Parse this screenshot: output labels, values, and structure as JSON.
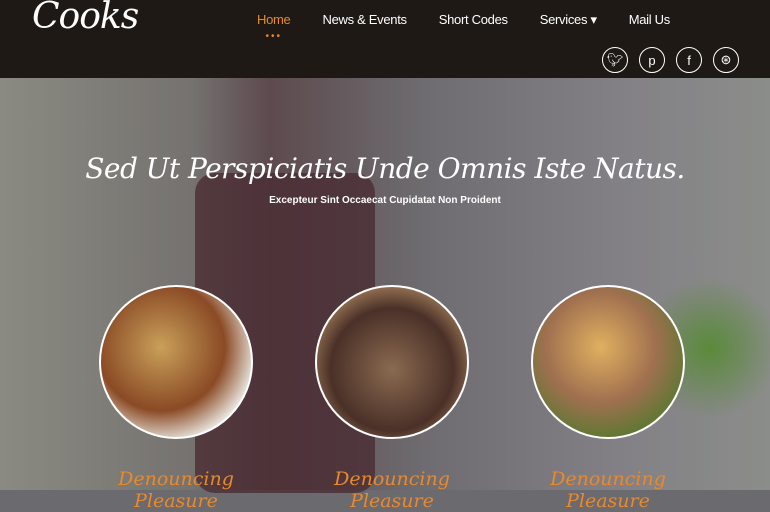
{
  "header": {
    "logo": "Cooks",
    "nav": [
      {
        "label": "Home",
        "active": true
      },
      {
        "label": "News & Events"
      },
      {
        "label": "Short Codes"
      },
      {
        "label": "Services ▾"
      },
      {
        "label": "Mail Us"
      }
    ],
    "active_indicator": "•••",
    "social": [
      "twitter-icon",
      "pinterest-icon",
      "facebook-icon",
      "dribbble-icon"
    ]
  },
  "hero": {
    "title": "Sed Ut Perspiciatis Unde Omnis Iste Natus.",
    "subtitle": "Excepteur Sint Occaecat Cupidatat Non Proident"
  },
  "dishes": [
    {
      "caption": "Denouncing Pleasure"
    },
    {
      "caption": "Denouncing Pleasure"
    },
    {
      "caption": "Denouncing Pleasure"
    }
  ],
  "colors": {
    "accent": "#e8892d",
    "header_bg": "#1e1915"
  }
}
